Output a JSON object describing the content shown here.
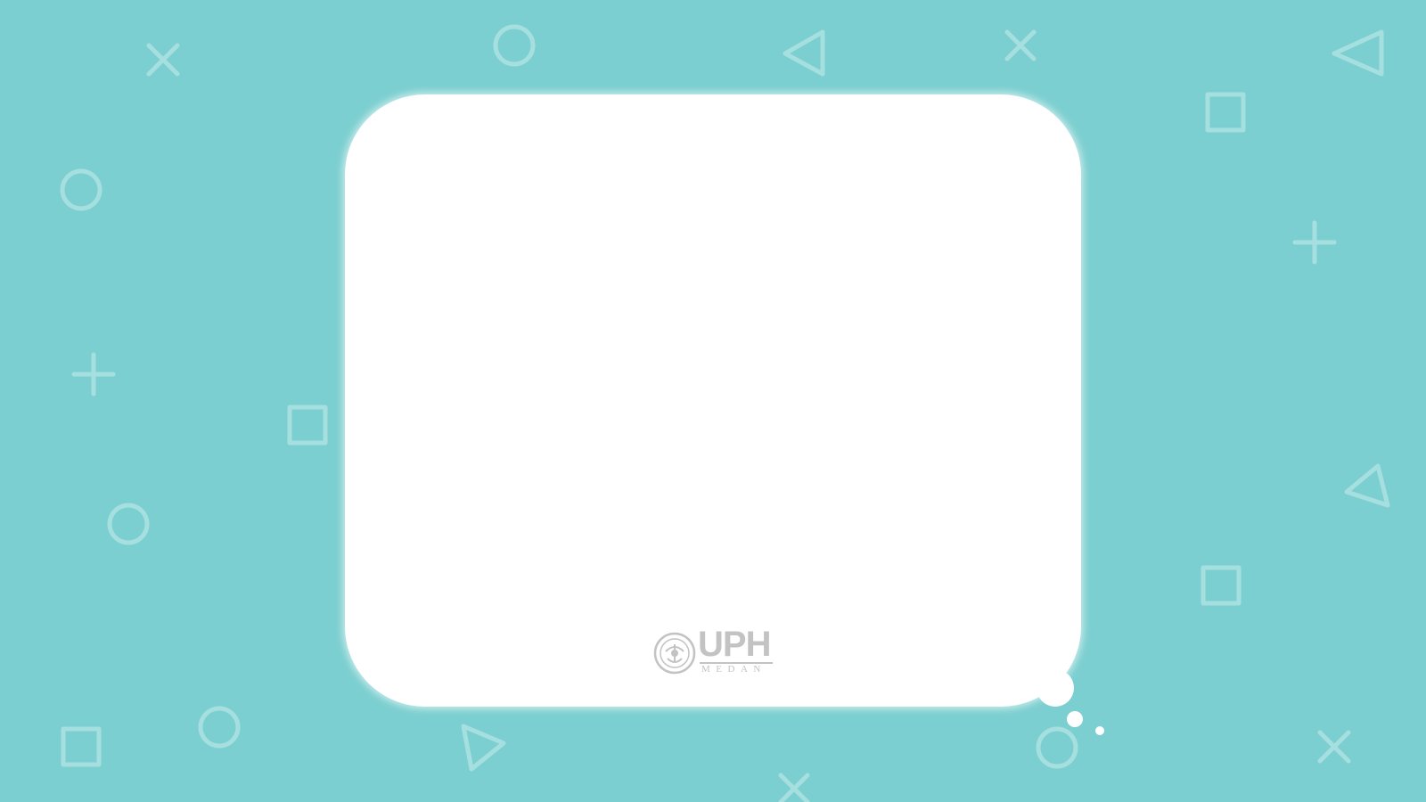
{
  "colors": {
    "background": "#7ccfd0",
    "shape_stroke": "#a6dfe0",
    "card": "#ffffff",
    "logo": "#c3c3c3"
  },
  "background_shapes": [
    "cross-icon",
    "circle-icon",
    "triangle-icon",
    "cross-icon",
    "triangle-icon",
    "square-icon",
    "circle-icon",
    "plus-icon",
    "plus-icon",
    "square-icon",
    "circle-icon",
    "triangle-icon",
    "square-icon",
    "square-icon",
    "circle-icon",
    "triangle-icon",
    "circle-icon",
    "cross-icon",
    "cross-icon"
  ],
  "card": {
    "type": "thought-bubble"
  },
  "logo": {
    "name": "UPH",
    "subtitle": "MEDAN"
  }
}
